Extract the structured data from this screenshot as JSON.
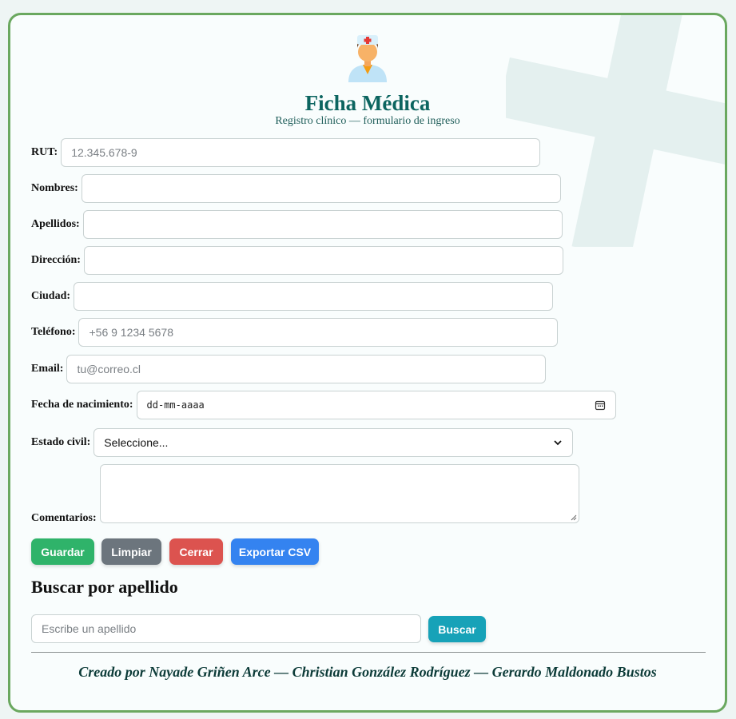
{
  "header": {
    "title": "Ficha Médica",
    "subtitle": "Registro clínico — formulario de ingreso",
    "icon": "doctor-icon"
  },
  "form": {
    "rut": {
      "label": "RUT:",
      "placeholder": "12.345.678-9",
      "value": ""
    },
    "nombres": {
      "label": "Nombres:",
      "placeholder": "",
      "value": ""
    },
    "apellidos": {
      "label": "Apellidos:",
      "placeholder": "",
      "value": ""
    },
    "direccion": {
      "label": "Dirección:",
      "placeholder": "",
      "value": ""
    },
    "ciudad": {
      "label": "Ciudad:",
      "placeholder": "",
      "value": ""
    },
    "telefono": {
      "label": "Teléfono:",
      "placeholder": "+56 9 1234 5678",
      "value": ""
    },
    "email": {
      "label": "Email:",
      "placeholder": "tu@correo.cl",
      "value": ""
    },
    "fecha": {
      "label": "Fecha de nacimiento:",
      "value": "dd-mm-aaaa"
    },
    "estado_civil": {
      "label": "Estado civil:",
      "selected": "Seleccione..."
    },
    "comentarios": {
      "label": "Comentarios:",
      "value": ""
    }
  },
  "buttons": {
    "guardar": "Guardar",
    "limpiar": "Limpiar",
    "cerrar": "Cerrar",
    "exportar": "Exportar CSV"
  },
  "search": {
    "title": "Buscar por apellido",
    "placeholder": "Escribe un apellido",
    "button": "Buscar"
  },
  "footer": {
    "credits": "Creado por Nayade Griñen Arce — Christian González Rodríguez — Gerardo Maldonado Bustos"
  },
  "colors": {
    "accent": "#0c6560",
    "border": "#6aa85f",
    "guardar": "#2fb36a",
    "limpiar": "#6c757d",
    "cerrar": "#dc534f",
    "exportar": "#3483f0",
    "buscar": "#17a2b8"
  }
}
